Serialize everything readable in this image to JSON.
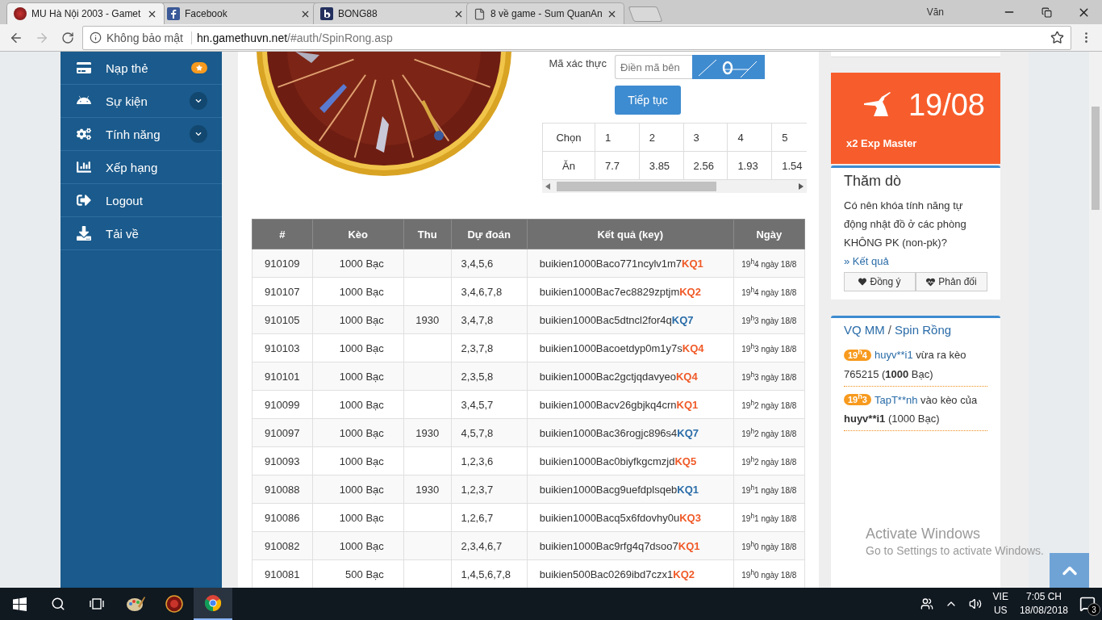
{
  "browser": {
    "tabs": [
      {
        "title": "MU Hà Nội 2003 - Gamet",
        "kind": "game",
        "selected": true
      },
      {
        "title": "Facebook",
        "kind": "facebook",
        "selected": false
      },
      {
        "title": "BONG88",
        "kind": "bong",
        "selected": false
      },
      {
        "title": "8 về game - Sum QuanAn",
        "kind": "page",
        "selected": false
      }
    ],
    "profile": "Văn",
    "security": "Không bảo mật",
    "url_host": "hn.gamethuvn.net",
    "url_path": "/#auth/SpinRong.asp"
  },
  "sidebar": {
    "items": [
      {
        "label": "Nạp thẻ",
        "kind": "card",
        "dropdown": false,
        "badge": true
      },
      {
        "label": "Sự kiện",
        "kind": "android",
        "dropdown": true,
        "badge": false
      },
      {
        "label": "Tính năng",
        "kind": "gears",
        "dropdown": true,
        "badge": false
      },
      {
        "label": "Xếp hạng",
        "kind": "chart",
        "dropdown": false,
        "badge": false
      },
      {
        "label": "Logout",
        "kind": "logout",
        "dropdown": false,
        "badge": false
      },
      {
        "label": "Tải về",
        "kind": "download",
        "dropdown": false,
        "badge": false
      }
    ]
  },
  "spin": {
    "captcha_label": "Mã xác thực",
    "captcha_placeholder": "Điền mã bên",
    "submit": "Tiếp tục",
    "odds": {
      "pick_label": "Chọn",
      "payout_label": "Ăn",
      "picks": [
        "1",
        "2",
        "3",
        "4",
        "5"
      ],
      "payouts": [
        "7.7",
        "3.85",
        "2.56",
        "1.93",
        "1.54"
      ]
    }
  },
  "history": {
    "columns": [
      "#",
      "Kèo",
      "Thu",
      "Dự đoán",
      "Kết quả (key)",
      "Ngày"
    ],
    "rows": [
      {
        "id": "910109",
        "stake": "1000 Bạc",
        "income": "",
        "picks": "3,4,5,6",
        "key": "buikien1000Baco771ncylv1m7",
        "result": "KQ1",
        "color": "#f05a28",
        "time": "19$^{h}$4 ngày 18/8"
      },
      {
        "id": "910107",
        "stake": "1000 Bạc",
        "income": "",
        "picks": "3,4,6,7,8",
        "key": "buikien1000Bac7ec8829zptjm",
        "result": "KQ2",
        "color": "#f05a28",
        "time": "19$^{h}$4 ngày 18/8"
      },
      {
        "id": "910105",
        "stake": "1000 Bạc",
        "income": "1930",
        "picks": "3,4,7,8",
        "key": "buikien1000Bac5dtncl2for4q",
        "result": "KQ7",
        "color": "#2a6ca8",
        "time": "19$^{h}$3 ngày 18/8"
      },
      {
        "id": "910103",
        "stake": "1000 Bạc",
        "income": "",
        "picks": "2,3,7,8",
        "key": "buikien1000Bacoetdyp0m1y7s",
        "result": "KQ4",
        "color": "#f05a28",
        "time": "19$^{h}$3 ngày 18/8"
      },
      {
        "id": "910101",
        "stake": "1000 Bạc",
        "income": "",
        "picks": "2,3,5,8",
        "key": "buikien1000Bac2gctjqdavyeo",
        "result": "KQ4",
        "color": "#f05a28",
        "time": "19$^{h}$3 ngày 18/8"
      },
      {
        "id": "910099",
        "stake": "1000 Bạc",
        "income": "",
        "picks": "3,4,5,7",
        "key": "buikien1000Bacv26gbjkq4crn",
        "result": "KQ1",
        "color": "#f05a28",
        "time": "19$^{h}$2 ngày 18/8"
      },
      {
        "id": "910097",
        "stake": "1000 Bạc",
        "income": "1930",
        "picks": "4,5,7,8",
        "key": "buikien1000Bac36rogjc896s4",
        "result": "KQ7",
        "color": "#2a6ca8",
        "time": "19$^{h}$2 ngày 18/8"
      },
      {
        "id": "910093",
        "stake": "1000 Bạc",
        "income": "",
        "picks": "1,2,3,6",
        "key": "buikien1000Bac0biyfkgcmzjd",
        "result": "KQ5",
        "color": "#f05a28",
        "time": "19$^{h}$2 ngày 18/8"
      },
      {
        "id": "910088",
        "stake": "1000 Bạc",
        "income": "1930",
        "picks": "1,2,3,7",
        "key": "buikien1000Bacg9uefdplsqeb",
        "result": "KQ1",
        "color": "#2a6ca8",
        "time": "19$^{h}$1 ngày 18/8"
      },
      {
        "id": "910086",
        "stake": "1000 Bạc",
        "income": "",
        "picks": "1,2,6,7",
        "key": "buikien1000Bacq5x6fdovhy0u",
        "result": "KQ3",
        "color": "#f05a28",
        "time": "19$^{h}$1 ngày 18/8"
      },
      {
        "id": "910082",
        "stake": "1000 Bạc",
        "income": "",
        "picks": "2,3,4,6,7",
        "key": "buikien1000Bac9rfg4q7dsoo7",
        "result": "KQ1",
        "color": "#f05a28",
        "time": "19$^{h}$0 ngày 18/8"
      },
      {
        "id": "910081",
        "stake": "500 Bạc",
        "income": "",
        "picks": "1,4,5,6,7,8",
        "key": "buikien500Bac0269ibd7czx1",
        "result": "KQ2",
        "color": "#f05a28",
        "time": "19$^{h}$0 ngày 18/8"
      }
    ]
  },
  "event_card": {
    "date": "19/08",
    "title": "x2 Exp Master"
  },
  "poll": {
    "title": "Thăm dò",
    "question": "Có nên khóa tính năng tự động nhật đồ ở các phòng KHÔNG PK (non-pk)?",
    "results_link": "» Kết quả",
    "agree": "Đồng ý",
    "disagree": "Phản đối"
  },
  "feed": {
    "title_link_1": "VQ MM",
    "separator": "/",
    "title_link_2": "Spin Rồng",
    "entries": [
      {
        "badge": "19$^{h}$4",
        "parts": [
          {
            "kind": "link",
            "text": "huyv**i1"
          },
          {
            "kind": "plain",
            "text": " vừa ra kèo 765215 ("
          },
          {
            "kind": "bold",
            "text": "1000"
          },
          {
            "kind": "plain",
            "text": " Bạc)"
          }
        ]
      },
      {
        "badge": "19$^{h}$3",
        "parts": [
          {
            "kind": "link",
            "text": "TapT**nh"
          },
          {
            "kind": "plain",
            "text": " vào kèo của "
          },
          {
            "kind": "bold",
            "text": "huyv**i1"
          },
          {
            "kind": "plain",
            "text": " (1000 Bạc)"
          }
        ]
      }
    ]
  },
  "activation_notice": {
    "title": "Activate Windows",
    "subtitle": "Go to Settings to activate Windows."
  },
  "taskbar": {
    "apps": [
      {
        "kind": "windows",
        "active": false
      },
      {
        "kind": "search",
        "active": false
      },
      {
        "kind": "taskview",
        "active": false
      },
      {
        "kind": "paint",
        "active": false
      },
      {
        "kind": "game",
        "active": false
      },
      {
        "kind": "chrome",
        "active": true
      }
    ],
    "language": "VIE",
    "region": "US",
    "time": "7:05 CH",
    "date": "18/08/2018",
    "notifications": "3"
  }
}
